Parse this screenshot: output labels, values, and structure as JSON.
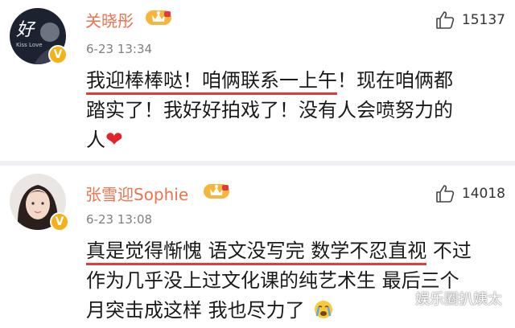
{
  "comments": [
    {
      "username": "关晓彤",
      "time": "6-23 13:34",
      "likes": "15137",
      "verified_icon": "v-badge-icon",
      "content_lines": [
        {
          "underlined": "我迎棒棒哒！咱俩联系一上午",
          "rest": "！现在咱俩都"
        },
        {
          "underlined": "",
          "rest": "踏实了！我好好拍戏了！没有人会喷努力的"
        },
        {
          "underlined": "",
          "rest": "人"
        }
      ],
      "emoji": "heart-emoji"
    },
    {
      "username": "张雪迎Sophie",
      "time": "6-23 13:08",
      "likes": "14018",
      "verified_icon": "v-badge-icon",
      "content_lines": [
        {
          "underlined": "真是觉得惭愧 语文没写完 数学不忍直视",
          "rest": " 不过"
        },
        {
          "underlined": "",
          "rest": "作为几乎没上过文化课的纯艺术生 最后三个"
        },
        {
          "underlined": "",
          "rest": "月突击成这样 我也尽力了"
        }
      ],
      "emoji": "crying-emoji"
    }
  ],
  "avatar_text": {
    "big": "好",
    "small": "Kiss Love"
  },
  "watermark": "娱乐圈扒姨太",
  "colors": {
    "username": "#eb7350",
    "underline": "#e33a3a",
    "badge": "#f5b01a",
    "heart": "#e0262b"
  }
}
